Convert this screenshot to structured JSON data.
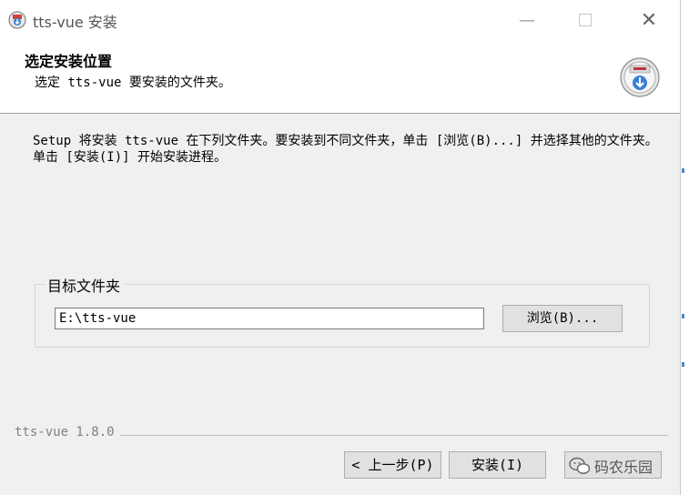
{
  "window": {
    "title": "tts-vue 安装",
    "controls": {
      "minimize": "—",
      "close": "✕"
    }
  },
  "header": {
    "title": "选定安装位置",
    "subtitle": "选定 tts-vue 要安装的文件夹。"
  },
  "body": {
    "description": "Setup 将安装 tts-vue 在下列文件夹。要安装到不同文件夹，单击 [浏览(B)...] 并选择其他的文件夹。 单击 [安装(I)] 开始安装进程。",
    "destination": {
      "label": "目标文件夹",
      "path_value": "E:\\tts-vue",
      "browse_label": "浏览(B)..."
    }
  },
  "footer": {
    "brand": "tts-vue 1.8.0",
    "back_label": "< 上一步(P)",
    "install_label": "安装(I)",
    "cancel_label": "",
    "watermark": "码农乐园"
  },
  "icons": {
    "app": "installer-app-icon",
    "header": "install-disk-icon",
    "watermark": "wechat-icon"
  },
  "colors": {
    "window_bg": "#f0f0f0",
    "header_bg": "#ffffff",
    "icon_accent": "#3b7fd4"
  }
}
